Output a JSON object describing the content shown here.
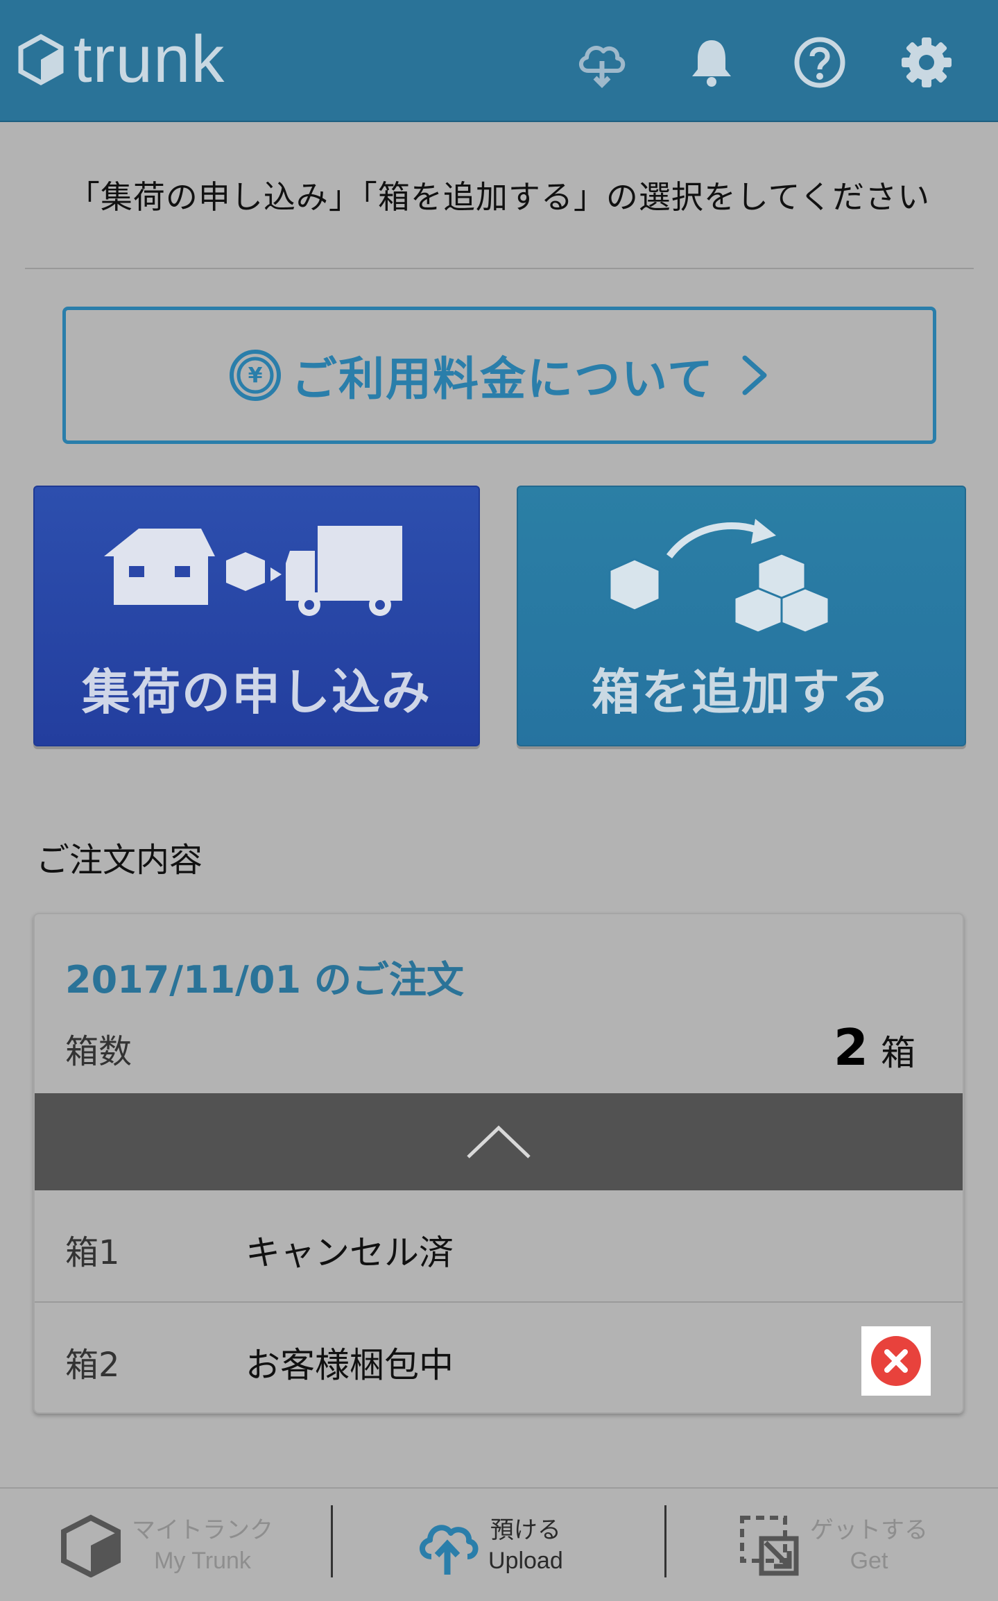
{
  "header": {
    "logo_text": "trunk",
    "icons": [
      "cloud-upload-icon",
      "bell-icon",
      "help-icon",
      "gear-icon"
    ]
  },
  "instruction": "「集荷の申し込み」「箱を追加する」の選択をしてください",
  "pricing": {
    "label": "ご利用料金について"
  },
  "tiles": {
    "pickup_label": "集荷の申し込み",
    "add_box_label": "箱を追加する"
  },
  "order": {
    "heading": "ご注文内容",
    "date_title": "2017/11/01 のご注文",
    "box_count_label": "箱数",
    "box_count": "2",
    "box_count_unit": "箱",
    "boxes": [
      {
        "name": "箱1",
        "status": "キャンセル済"
      },
      {
        "name": "箱2",
        "status": "お客様梱包中"
      }
    ]
  },
  "bottom_nav": {
    "items": [
      {
        "ja": "マイトランク",
        "en": "My Trunk"
      },
      {
        "ja": "預ける",
        "en": "Upload"
      },
      {
        "ja": "ゲットする",
        "en": "Get"
      }
    ]
  },
  "colors": {
    "header_bg": "#2a7398",
    "accent": "#2a7eaa",
    "pickup_tile": "#2b4aa8",
    "add_tile": "#2879a3",
    "cancel_red": "#e8423c",
    "background": "#b3b3b3"
  }
}
